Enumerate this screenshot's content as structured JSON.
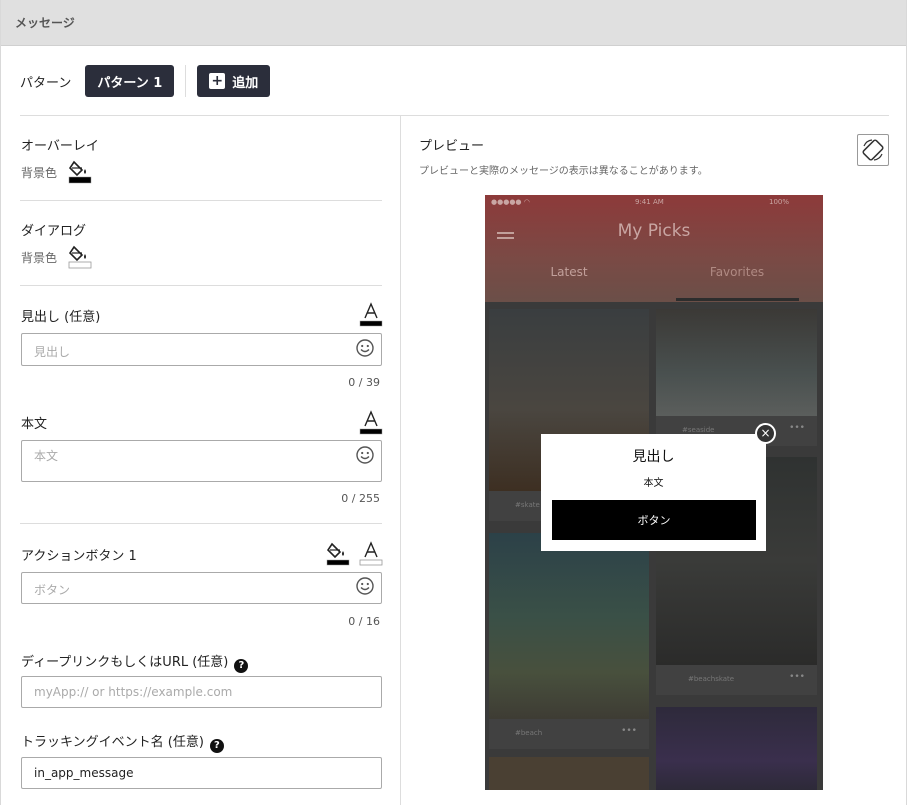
{
  "header": {
    "title": "メッセージ"
  },
  "pattern": {
    "label": "パターン",
    "active_tab": "パターン 1",
    "add_label": "追加"
  },
  "overlay": {
    "title": "オーバーレイ",
    "bg_label": "背景色",
    "bg_color": "#000000"
  },
  "dialog": {
    "title": "ダイアログ",
    "bg_label": "背景色",
    "bg_color": "#ffffff"
  },
  "heading_field": {
    "label": "見出し (任意)",
    "placeholder": "見出し",
    "counter": "0 / 39",
    "text_color": "#000000"
  },
  "body_field": {
    "label": "本文",
    "placeholder": "本文",
    "counter": "0 / 255",
    "text_color": "#000000"
  },
  "action_button": {
    "label": "アクションボタン 1",
    "placeholder": "ボタン",
    "counter": "0 / 16",
    "bg_color": "#000000",
    "text_color": "#ffffff"
  },
  "deeplink": {
    "label": "ディープリンクもしくはURL (任意)",
    "placeholder": "myApp:// or https://example.com"
  },
  "tracking": {
    "label": "トラッキングイベント名 (任意)",
    "value": "in_app_message"
  },
  "preview": {
    "title": "プレビュー",
    "note": "プレビューと実際のメッセージの表示は異なることがあります。",
    "phone": {
      "status_time": "9:41 AM",
      "battery": "100%",
      "app_title": "My Picks",
      "tabs": [
        "Latest",
        "Favorites"
      ],
      "tags": [
        "#seaside",
        "#skate",
        "#beachskate",
        "#beach"
      ]
    },
    "modal": {
      "heading": "見出し",
      "body": "本文",
      "button": "ボタン"
    }
  }
}
